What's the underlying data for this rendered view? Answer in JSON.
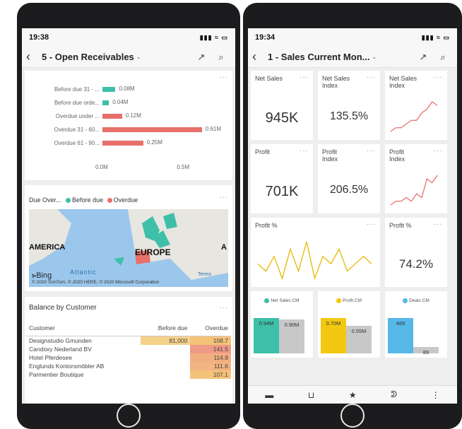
{
  "phone1": {
    "time": "19:38",
    "status_icons": "▮▮▮ ≈ ▭",
    "title": "5 - Open Receivables",
    "bar_chart": {
      "chart_data": {
        "type": "bar",
        "orientation": "horizontal",
        "categories": [
          "Before due 31 - ...",
          "Before due orde...",
          "Overdue under ...",
          "Overdue 31 - 60...",
          "Overdue 61 - 90..."
        ],
        "values": [
          0.08,
          0.04,
          0.12,
          0.61,
          0.25
        ],
        "labels": [
          "0.08M",
          "0.04M",
          "0.12M",
          "0.61M",
          "0.25M"
        ],
        "colors": [
          "#3dbfa8",
          "#3dbfa8",
          "#e8706a",
          "#e8706a",
          "#e8706a"
        ],
        "xticks": [
          "0.0M",
          "0.5M"
        ],
        "xlim": [
          0,
          0.65
        ]
      }
    },
    "map": {
      "title": "Due Over...",
      "legend": [
        {
          "label": "Before due",
          "color": "#3dbfa8"
        },
        {
          "label": "Overdue",
          "color": "#e8706a"
        }
      ],
      "labels": {
        "america": "AMERICA",
        "europe": "EUROPE",
        "atlantic": "Atlantic",
        "edge": "A"
      },
      "bing": "Bing",
      "copyright": "© 2020 TomTom, © 2020 HERE, © 2020 Microsoft Corporation",
      "terms": "Terms"
    },
    "table": {
      "title": "Balance by Customer",
      "headers": [
        "Customer",
        "Before due",
        "Overdue"
      ],
      "rows": [
        [
          "Designstudio Gmunden",
          "81,000",
          "108.7"
        ],
        [
          "Candoxy Nederland BV",
          "",
          "141.5"
        ],
        [
          "Hotel Pferdesee",
          "",
          "114.9"
        ],
        [
          "Englunds Kontorsmöbler AB",
          "",
          "111.6"
        ],
        [
          "Parmentier Boutique",
          "",
          "107.1"
        ]
      ]
    }
  },
  "phone2": {
    "time": "19:34",
    "status_icons": "▮▮▮ ≈ ▭",
    "title": "1 - Sales Current Mon...",
    "tiles": {
      "net_sales": {
        "title": "Net Sales",
        "value": "945K"
      },
      "net_sales_index": {
        "title": "Net Sales Index",
        "value": "135.5%"
      },
      "net_sales_index_chart": {
        "title": "Net Sales Index"
      },
      "profit": {
        "title": "Profit",
        "value": "701K"
      },
      "profit_index": {
        "title": "Profit Index",
        "value": "206.5%"
      },
      "profit_index_chart": {
        "title": "Profit Index"
      },
      "profit_pct_chart": {
        "title": "Profit %"
      },
      "profit_pct": {
        "title": "Profit %",
        "value": "74.2%"
      }
    },
    "mini_charts": [
      {
        "legend": "Net Sales CM",
        "color": "#3dbfa8",
        "bars": [
          {
            "label": "0.94M",
            "value": 0.94,
            "color": "#3dbfa8"
          },
          {
            "label": "0.90M",
            "value": 0.9,
            "color": "#c8c8c8"
          }
        ]
      },
      {
        "legend": "Profit CM",
        "color": "#f2c811",
        "bars": [
          {
            "label": "0.70M",
            "value": 0.7,
            "color": "#f2c811"
          },
          {
            "label": "0.55M",
            "value": 0.55,
            "color": "#c8c8c8"
          }
        ]
      },
      {
        "legend": "Deals CM",
        "color": "#55b8e8",
        "bars": [
          {
            "label": "489",
            "value": 489,
            "color": "#55b8e8"
          },
          {
            "label": "89",
            "value": 89,
            "color": "#c8c8c8"
          }
        ]
      }
    ],
    "sparklines": {
      "net_sales_index": [
        2,
        3,
        3,
        4,
        5,
        5,
        7,
        8,
        10,
        9
      ],
      "profit_index": [
        2,
        3,
        3,
        4,
        3,
        5,
        4,
        9,
        8,
        10
      ],
      "profit_pct": [
        5,
        4,
        6,
        3,
        7,
        4,
        8,
        3,
        6,
        5,
        7,
        4,
        5,
        6,
        5
      ],
      "colors": {
        "red": "#e8706a",
        "yellow": "#e8b800"
      }
    },
    "nav": {
      "chat": "▬",
      "cart": "⊔",
      "star": "★",
      "user": "ᕲ",
      "more": "⋮"
    }
  },
  "icons": {
    "back": "‹",
    "expand": "↗",
    "search": "⌕",
    "more": "···",
    "chevron": "⌄"
  }
}
